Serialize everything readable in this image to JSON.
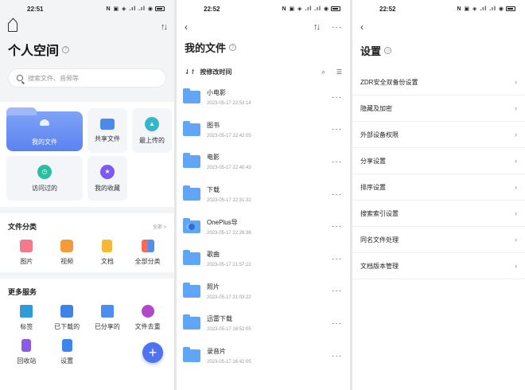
{
  "status_times": [
    "22:51",
    "22:52",
    "22:52"
  ],
  "status_icons": "N ▣ ◈ .ıl .ıl ◉",
  "colors": {
    "accent": "#5c82f0",
    "folder": "#61a6f6",
    "fab": "#4f72ef"
  },
  "screen1": {
    "title": "个人空间",
    "search_placeholder": "搜索文件、音频等",
    "quick": {
      "main_folder": "我的文件",
      "shared": "共享文件",
      "recent_upload": "最上传的",
      "recent_visited": "访问过的",
      "favorites": "我的收藏"
    },
    "categories": {
      "title": "文件分类",
      "more": "全部 >",
      "items": [
        "图片",
        "视频",
        "文档",
        "全部分类"
      ]
    },
    "services": {
      "title": "更多服务",
      "items": [
        "标签",
        "已下载的",
        "已分享的",
        "文件去重",
        "回收站",
        "设置"
      ]
    },
    "fab": "+"
  },
  "screen2": {
    "title": "我的文件",
    "sort_label": "按修改时间",
    "files": [
      {
        "name": "小电影",
        "date": "2023-05-17 22:53:14"
      },
      {
        "name": "图书",
        "date": "2023-05-17 22:42:05"
      },
      {
        "name": "电影",
        "date": "2023-05-17 22:40:43"
      },
      {
        "name": "下载",
        "date": "2023-05-17 22:31:32"
      },
      {
        "name": "OnePlus导",
        "date": "2023-05-17 22:26:36"
      },
      {
        "name": "歌曲",
        "date": "2023-05-17 21:57:22"
      },
      {
        "name": "照片",
        "date": "2023-05-17 21:03:22"
      },
      {
        "name": "迅雷下载",
        "date": "2023-05-17 16:52:05"
      },
      {
        "name": "录音片",
        "date": "2023-05-17 16:42:05"
      }
    ]
  },
  "screen3": {
    "title": "设置",
    "items": [
      "ZDR安全双备份设置",
      "隐藏及加密",
      "外部设备权限",
      "分享设置",
      "排序设置",
      "搜索索引设置",
      "同名文件处理",
      "文档版本管理"
    ]
  }
}
